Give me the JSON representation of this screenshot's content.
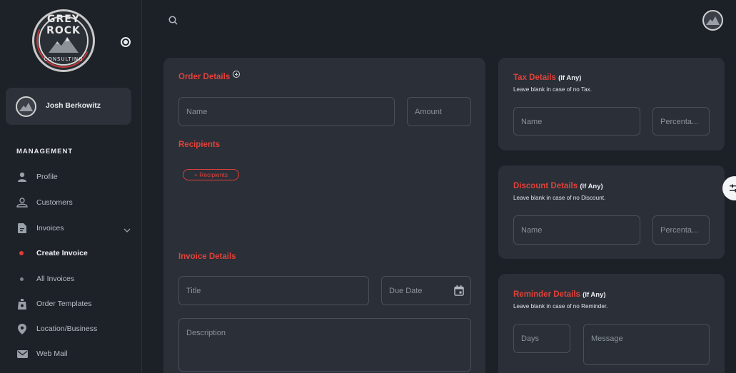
{
  "brand": {
    "logo_top": "GREY ROCK",
    "logo_bottom": "CONSULTING"
  },
  "user": {
    "name": "Josh Berkowitz"
  },
  "sidebar": {
    "section": "MANAGEMENT",
    "items": [
      {
        "label": "Profile",
        "icon": "person-icon"
      },
      {
        "label": "Customers",
        "icon": "customers-icon"
      },
      {
        "label": "Invoices",
        "icon": "invoice-icon"
      },
      {
        "label": "Create Invoice",
        "icon": "dot"
      },
      {
        "label": "All Invoices",
        "icon": "dot"
      },
      {
        "label": "Order Templates",
        "icon": "bag-icon"
      },
      {
        "label": "Location/Business",
        "icon": "location-icon"
      },
      {
        "label": "Web Mail",
        "icon": "mail-icon"
      }
    ]
  },
  "order": {
    "title": "Order Details",
    "name_placeholder": "Name",
    "amount_placeholder": "Amount",
    "recipients_title": "Recipients",
    "recipients_button": "+ Recipients"
  },
  "invoice": {
    "title": "Invoice Details",
    "title_placeholder": "Title",
    "due_placeholder": "Due Date",
    "description_placeholder": "Description"
  },
  "tax": {
    "title": "Tax Details",
    "suffix": "(If Any)",
    "note": "Leave blank in case of no Tax.",
    "name_placeholder": "Name",
    "pct_placeholder": "Percenta..."
  },
  "discount": {
    "title": "Discount Details",
    "suffix": "(If Any)",
    "note": "Leave blank in case of no Discount.",
    "name_placeholder": "Name",
    "pct_placeholder": "Percenta..."
  },
  "reminder": {
    "title": "Reminder Details",
    "suffix": "(If Any)",
    "note": "Leave blank in case of no Reminder.",
    "days_placeholder": "Days",
    "message_placeholder": "Message"
  },
  "colors": {
    "accent": "#e0423a",
    "background": "#1c2027",
    "card": "#2a2f38"
  }
}
